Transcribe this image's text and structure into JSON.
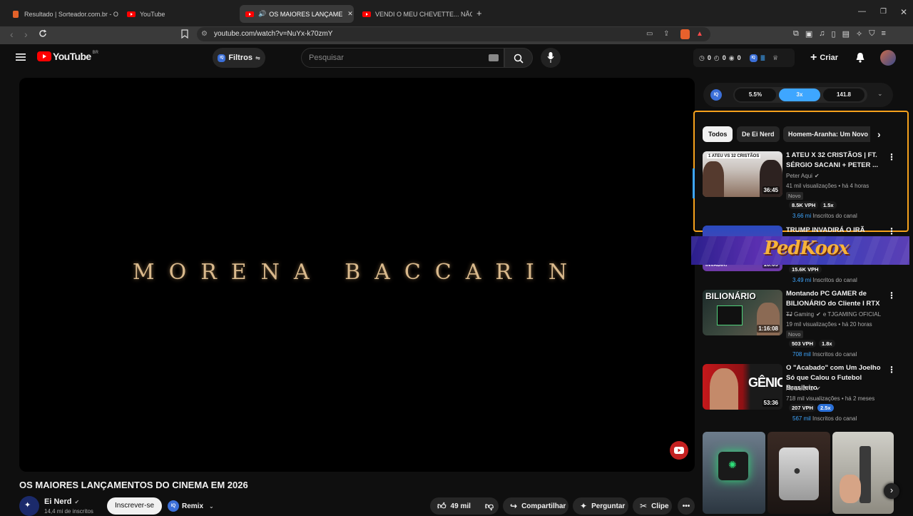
{
  "browser": {
    "tabs": [
      {
        "title": "Resultado | Sorteador.com.br - O Site",
        "active": false
      },
      {
        "title": "YouTube",
        "active": false
      },
      {
        "title": "OS MAIORES LANÇAMENTOS",
        "active": true
      },
      {
        "title": "VENDI O MEU CHEVETTE... NÃO AGU",
        "active": false
      }
    ],
    "url": "youtube.com/watch?v=NuYx-k70zmY"
  },
  "header": {
    "logo_text": "YouTube",
    "logo_region": "BR",
    "filters_label": "Filtros",
    "search_placeholder": "Pesquisar",
    "counters": [
      "0",
      "0",
      "0"
    ],
    "create_label": "Criar"
  },
  "extension_bar": {
    "iq_label": "IQ",
    "left_value": "5.5%",
    "middle_value": "3x",
    "right_value": "141.8"
  },
  "video": {
    "overlay_text": "MORENA BACCARIN",
    "title": "OS MAIORES LANÇAMENTOS DO CINEMA EM 2026",
    "channel_name": "Ei Nerd",
    "channel_subs": "14,4 mi de inscritos",
    "subscribe_label": "Inscrever-se",
    "remix_label": "Remix",
    "like_count": "49 mil",
    "share_label": "Compartilhar",
    "ask_label": "Perguntar",
    "clip_label": "Clipe"
  },
  "chips": [
    "Todos",
    "De Ei Nerd",
    "Homem-Aranha: Um Novo"
  ],
  "recommendations": [
    {
      "title": "1 ATEU X 32 CRISTÃOS | FT. SÉRGIO SACANI + PETER ...",
      "channel": "Peter Aqui",
      "stats": "41 mil visualizações • há 4 horas",
      "new_badge": "Novo",
      "vph": "8.5K VPH",
      "mult": "1.5x",
      "subs_value": "3.66 mi",
      "subs_label": "Inscritos do canal",
      "duration": "36:45",
      "thumb_text": "1 ATEU VS 32 CRISTÃOS"
    },
    {
      "title": "TRUMP INVADIRÁ O IRÃ",
      "channel": "",
      "stats": "",
      "vph": "15.6K VPH",
      "subs_value": "3.49 mi",
      "subs_label": "Inscritos do canal",
      "duration": "16:09",
      "thumb_text": "INVADIR!"
    },
    {
      "title": "Montando PC GAMER de BILIONÁRIO do Cliente I RTX ...",
      "channel": "TJ Gaming",
      "channel_extra": "e TJGAMING OFICIAL",
      "stats": "19 mil visualizações • há 20 horas",
      "new_badge": "Novo",
      "vph": "503 VPH",
      "mult": "1.8x",
      "subs_value": "708 mil",
      "subs_label": "Inscritos do canal",
      "duration": "1:16:08",
      "thumb_text": "BILIONÁRIO"
    },
    {
      "title": "O \"Acabado\" com Um Joelho Só que Calou o Futebol Brasileiro",
      "channel": "AUGUZTO",
      "stats": "718 mil visualizações • há 2 meses",
      "vph": "207 VPH",
      "mult": "2.5x",
      "subs_value": "567 mil",
      "subs_label": "Inscritos do canal",
      "duration": "53:36",
      "thumb_text": "GÊNIO"
    }
  ],
  "banner_text": "PedKoox",
  "colors": {
    "accent_orange": "#f5a11c",
    "youtube_red": "#ff0000",
    "link_blue": "#3ea6ff",
    "iq_blue": "#3b6fd8"
  }
}
